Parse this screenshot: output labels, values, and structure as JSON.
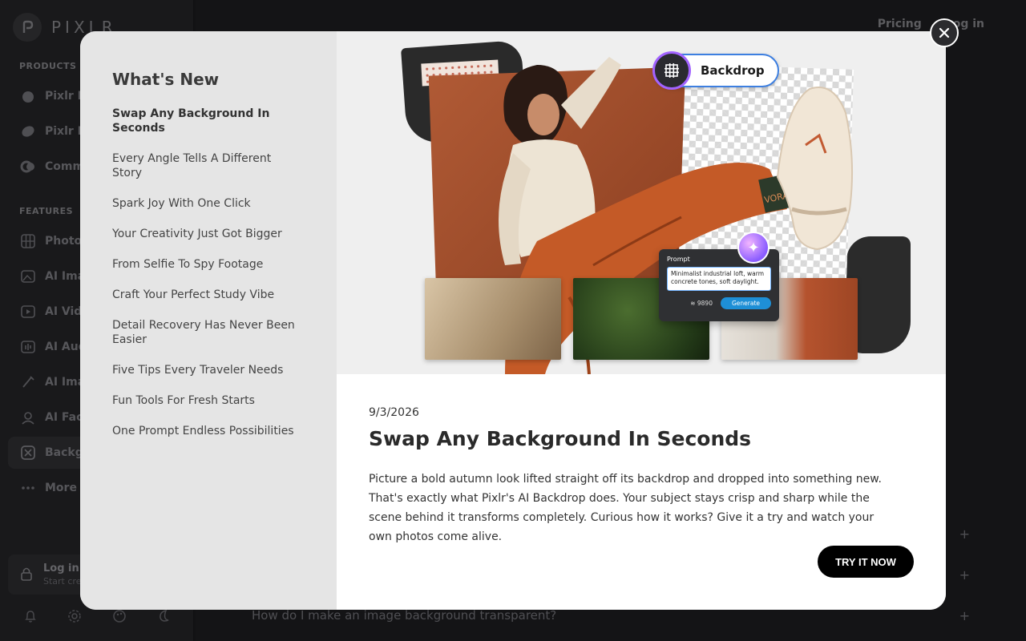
{
  "app": {
    "logo_text": "PIXLR"
  },
  "sidebar": {
    "products_label": "PRODUCTS",
    "products": [
      {
        "label": "Pixlr Express",
        "icon": "express-icon"
      },
      {
        "label": "Pixlr Editor",
        "icon": "editor-icon"
      },
      {
        "label": "Community",
        "icon": "community-icon"
      }
    ],
    "features_label": "FEATURES",
    "features": [
      {
        "label": "Photo Collage",
        "icon": "grid-icon"
      },
      {
        "label": "AI Image Generator",
        "icon": "image-gen-icon"
      },
      {
        "label": "AI Video Generator",
        "icon": "video-gen-icon"
      },
      {
        "label": "AI Audio Generator",
        "icon": "audio-icon"
      },
      {
        "label": "AI Image Editor",
        "icon": "brush-icon"
      },
      {
        "label": "AI Face Swap",
        "icon": "face-icon"
      },
      {
        "label": "Background Remover",
        "icon": "background-icon"
      },
      {
        "label": "More",
        "icon": "more-dots-icon"
      }
    ],
    "login_title": "Log in",
    "login_sub": "Start creating"
  },
  "topnav": {
    "pricing": "Pricing",
    "login": "Log in"
  },
  "faq": [
    {
      "question": ""
    },
    {
      "question": ""
    },
    {
      "question": "How do I make an image background transparent?"
    }
  ],
  "modal": {
    "heading": "What's New",
    "items": [
      "Swap Any Background In Seconds",
      "Every Angle Tells A Different Story",
      "Spark Joy With One Click",
      "Your Creativity Just Got Bigger",
      "From Selfie To Spy Footage",
      "Craft Your Perfect Study Vibe",
      "Detail Recovery Has Never Been Easier",
      "Five Tips Every Traveler Needs",
      "Fun Tools For Fresh Starts",
      "One Prompt Endless Possibilities"
    ],
    "hero": {
      "pill_label": "Backdrop",
      "prompt_label": "Prompt",
      "prompt_text": "Minimalist industrial loft, warm concrete tones, soft daylight.",
      "credits": "9890",
      "generate_label": "Generate",
      "sock_text": "VORAN"
    },
    "article": {
      "date": "9/3/2026",
      "title": "Swap Any Background In Seconds",
      "body": "Picture a bold autumn look lifted straight off its backdrop and dropped into something new. That's exactly what Pixlr's AI Backdrop does. Your subject stays crisp and sharp while the scene behind it transforms completely. Curious how it works? Give it a try and watch your own photos come alive.",
      "cta": "TRY IT NOW"
    }
  },
  "colors": {
    "cta_bg": "#000000",
    "accent_blue": "#1e8fd6",
    "sidebar_bg": "#27272a"
  }
}
